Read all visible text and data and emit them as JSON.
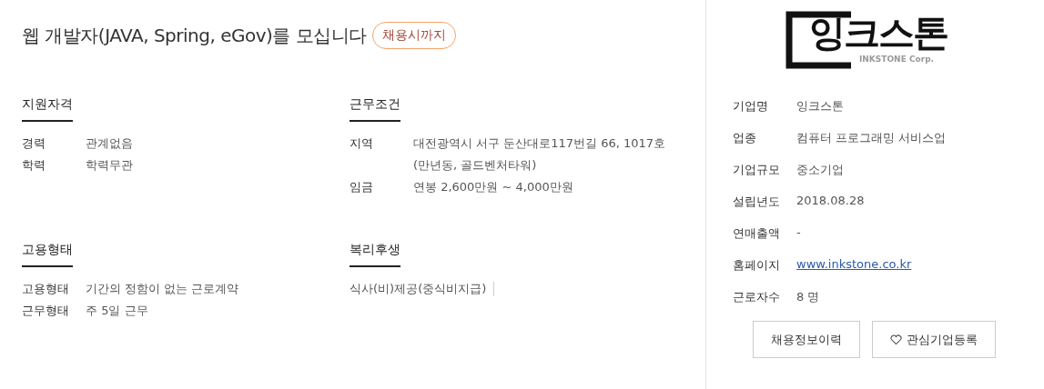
{
  "title": "웹 개발자(JAVA, Spring, eGov)를 모십니다",
  "deadline_badge": "채용시까지",
  "sections": [
    {
      "heading": "지원자격",
      "kind": "table",
      "rows": [
        {
          "label": "경력",
          "value": "관계없음"
        },
        {
          "label": "학력",
          "value": "학력무관"
        }
      ]
    },
    {
      "heading": "근무조건",
      "kind": "table",
      "rows": [
        {
          "label": "지역",
          "value": "대전광역시 서구 둔산대로117번길 66, 1017호 (만년동, 골드벤처타워)"
        },
        {
          "label": "임금",
          "value": "연봉 2,600만원 ~ 4,000만원"
        }
      ]
    },
    {
      "heading": "고용형태",
      "kind": "table",
      "rows": [
        {
          "label": "고용형태",
          "value": "기간의 정함이 없는 근로계약"
        },
        {
          "label": "근무형태",
          "value": "주 5일 근무"
        }
      ]
    },
    {
      "heading": "복리후생",
      "kind": "tags",
      "items": [
        "식사(비)제공(중식비지급)"
      ]
    }
  ],
  "company": {
    "logo": {
      "name": "잉크스톤",
      "subtitle": "INKSTONE Corp."
    },
    "rows": [
      {
        "label": "기업명",
        "value": "잉크스톤",
        "kind": "text"
      },
      {
        "label": "업종",
        "value": "컴퓨터 프로그래밍 서비스업",
        "kind": "text"
      },
      {
        "label": "기업규모",
        "value": "중소기업",
        "kind": "text"
      },
      {
        "label": "설립년도",
        "value": "2018.08.28",
        "kind": "text"
      },
      {
        "label": "연매출액",
        "value": "-",
        "kind": "text"
      },
      {
        "label": "홈페이지",
        "value": "www.inkstone.co.kr",
        "kind": "link"
      },
      {
        "label": "근로자수",
        "value": "8 명",
        "kind": "text"
      }
    ],
    "buttons": [
      {
        "label": "채용정보이력",
        "kind": "plain"
      },
      {
        "label": "관심기업등록",
        "kind": "favorite"
      }
    ]
  }
}
